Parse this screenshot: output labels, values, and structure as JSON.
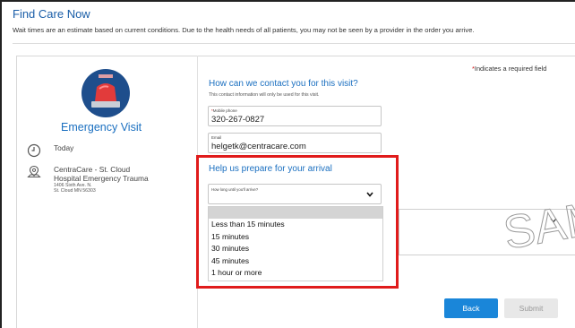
{
  "header": {
    "title": "Find Care Now",
    "subtitle": "Wait times are an estimate based on current conditions. Due to the health needs of all patients, you may not be seen by a provider in the order you arrive."
  },
  "visit": {
    "title": "Emergency Visit",
    "day": "Today",
    "location_name_1": "CentraCare - St. Cloud",
    "location_name_2": "Hospital Emergency Trauma",
    "address_1": "1406 Sixth Ave. N.",
    "address_2": "St. Cloud MN 56303"
  },
  "form": {
    "required_note": "Indicates a required field",
    "required_star": "*",
    "contact_heading": "How can we contact you for this visit?",
    "contact_note": "This contact information will only be used for this visit.",
    "phone_label": "Mobile phone",
    "phone_value": "320-267-0827",
    "email_label": "Email",
    "email_value": "helgetk@centracare.com",
    "prepare_heading": "Help us prepare for your arrival",
    "arrival_label": "How long until you'll arrive?",
    "arrival_options": [
      "Less than 15 minutes",
      "15 minutes",
      "30 minutes",
      "45 minutes",
      "1 hour or more"
    ],
    "watermark": "SAMPLE"
  },
  "actions": {
    "back_label": "Back",
    "submit_label": "Submit"
  },
  "colors": {
    "accent": "#1a6fc0",
    "highlight": "#e01b1b",
    "back_button": "#1a86d9"
  },
  "icons": [
    "siren-icon",
    "clock-icon",
    "location-pin-icon",
    "chevron-down-icon"
  ]
}
